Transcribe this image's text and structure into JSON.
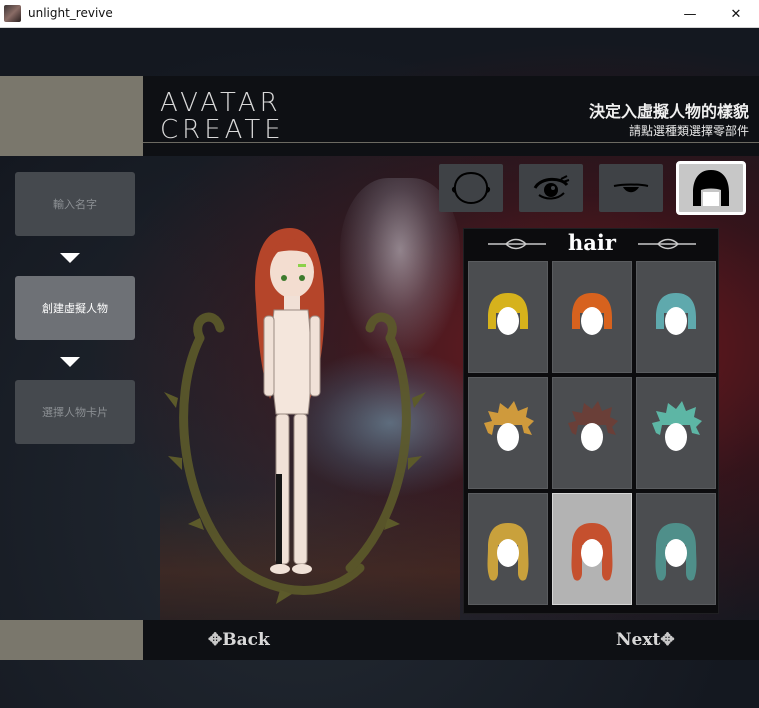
{
  "window": {
    "title": "unlight_revive",
    "minimize_glyph": "—",
    "close_glyph": "✕"
  },
  "header": {
    "title_line1": "AVATAR",
    "title_line2": "CREATE",
    "heading": "決定入虛擬人物的樣貌",
    "subheading": "請點選種類選擇零部件"
  },
  "steps": [
    {
      "label": "輸入名字",
      "active": false
    },
    {
      "label": "創建虛擬人物",
      "active": true
    },
    {
      "label": "選擇人物卡片",
      "active": false
    }
  ],
  "categories": [
    {
      "icon": "face-outline-icon",
      "selected": false
    },
    {
      "icon": "eye-icon",
      "selected": false
    },
    {
      "icon": "mouth-icon",
      "selected": false
    },
    {
      "icon": "hair-icon",
      "selected": true
    }
  ],
  "hair_panel": {
    "title": "hair",
    "selected_index": 7,
    "options": [
      {
        "style": "bob",
        "color": "#d6b21c"
      },
      {
        "style": "bob",
        "color": "#d7621e"
      },
      {
        "style": "bob",
        "color": "#5fa9ad"
      },
      {
        "style": "spiky",
        "color": "#cf9a3c"
      },
      {
        "style": "spiky",
        "color": "#6a3f38"
      },
      {
        "style": "spiky",
        "color": "#5db6a5"
      },
      {
        "style": "long-wavy",
        "color": "#c9a13c"
      },
      {
        "style": "long-wavy",
        "color": "#c5502e"
      },
      {
        "style": "long-wavy",
        "color": "#4f8f8a"
      }
    ]
  },
  "footer": {
    "back_label": "Back",
    "next_label": "Next",
    "ornament": "✥"
  },
  "colors": {
    "accent_block": "#7a776c",
    "header_bg": "#0e1014",
    "background_red": "#961920"
  }
}
